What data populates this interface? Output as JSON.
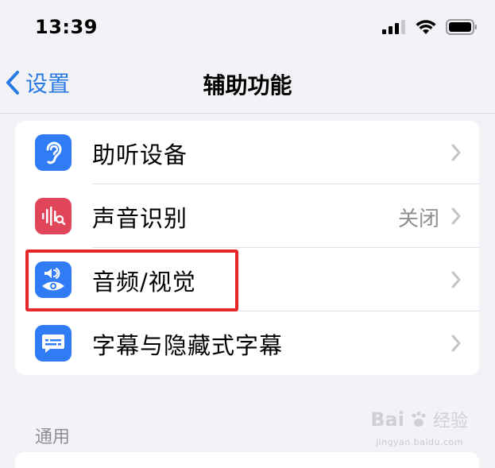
{
  "status_bar": {
    "time": "13:39"
  },
  "nav": {
    "back_label": "设置",
    "title": "辅助功能"
  },
  "rows": [
    {
      "label": "助听设备",
      "value": "",
      "icon": "ear-icon",
      "color": "#2f7cf6"
    },
    {
      "label": "声音识别",
      "value": "关闭",
      "icon": "sound-recognition-icon",
      "color": "#e0455a"
    },
    {
      "label": "音频/视觉",
      "value": "",
      "icon": "audio-visual-icon",
      "color": "#2f7cf6"
    },
    {
      "label": "字幕与隐藏式字幕",
      "value": "",
      "icon": "subtitles-icon",
      "color": "#2f7cf6"
    }
  ],
  "section_header": "通用",
  "watermark": {
    "brand": "Bai",
    "brand2": "经验",
    "sub": "jingyan.baidu.com"
  },
  "colors": {
    "accent": "#2a7ae4",
    "highlight": "#e8262c",
    "background": "#f2f2f7"
  }
}
